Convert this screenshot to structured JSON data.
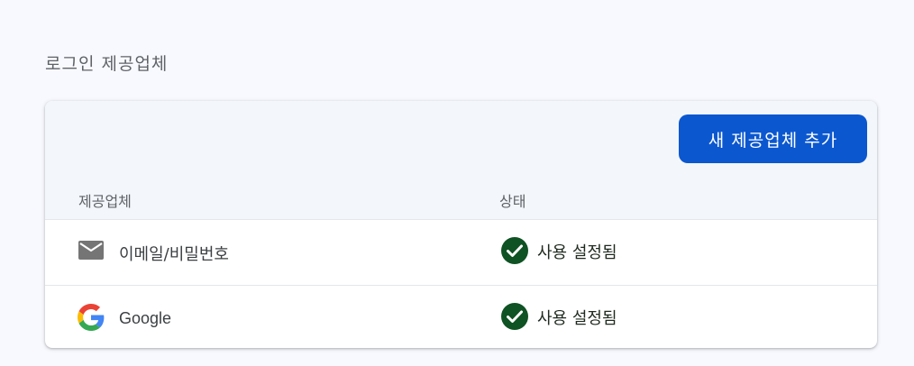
{
  "section_title": "로그인 제공업체",
  "add_provider_button": "새 제공업체 추가",
  "table": {
    "columns": {
      "provider": "제공업체",
      "status": "상태"
    },
    "rows": [
      {
        "provider": "이메일/비밀번호",
        "provider_icon": "mail-icon",
        "status": "사용 설정됨",
        "status_icon": "check-circle-icon"
      },
      {
        "provider": "Google",
        "provider_icon": "google-logo-icon",
        "status": "사용 설정됨",
        "status_icon": "check-circle-icon"
      }
    ]
  },
  "colors": {
    "primary_button": "#0b57d0",
    "status_enabled": "#0f5223",
    "background": "#f8f9fe"
  }
}
